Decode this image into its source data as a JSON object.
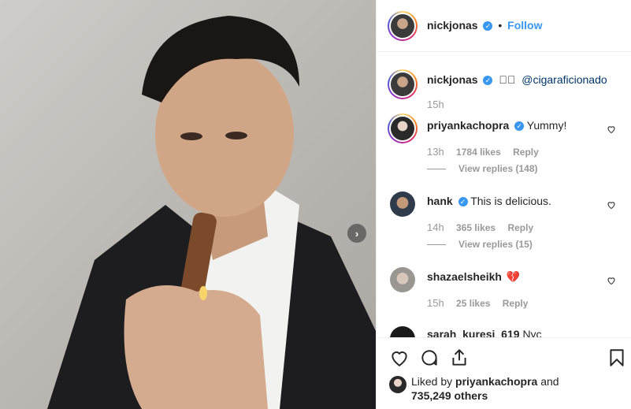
{
  "post": {
    "author": "nickjonas",
    "follow_label": "Follow",
    "separator": "•"
  },
  "caption": {
    "author": "nickjonas",
    "tag": "@cigaraficionado",
    "time": "15h"
  },
  "comments": [
    {
      "user": "priyankachopra",
      "verified": true,
      "text": "Yummy!",
      "time": "13h",
      "likes": "1784 likes",
      "reply_label": "Reply",
      "view_replies": "View replies (148)"
    },
    {
      "user": "hank",
      "verified": true,
      "text": "This is delicious.",
      "time": "14h",
      "likes": "365 likes",
      "reply_label": "Reply",
      "view_replies": "View replies (15)"
    },
    {
      "user": "shazaelsheikh",
      "verified": false,
      "text": "",
      "time": "15h",
      "likes": "25 likes",
      "reply_label": "Reply"
    },
    {
      "user": "sarah_kuresi_619",
      "text": "Nyc"
    }
  ],
  "liked_by": {
    "prefix": "Liked by",
    "user": "priyankachopra",
    "and": "and",
    "count": "735,249 others"
  },
  "icons": {
    "like": "heart-icon",
    "comment": "comment-icon",
    "share": "share-icon",
    "save": "bookmark-icon",
    "next": "chevron-right-icon",
    "verified": "verified-badge-icon",
    "tag": "tag-icon",
    "broken_heart": "broken-heart-emoji"
  },
  "colors": {
    "accent": "#3897f0",
    "muted": "#999999",
    "text": "#262626",
    "border": "#efefef"
  }
}
